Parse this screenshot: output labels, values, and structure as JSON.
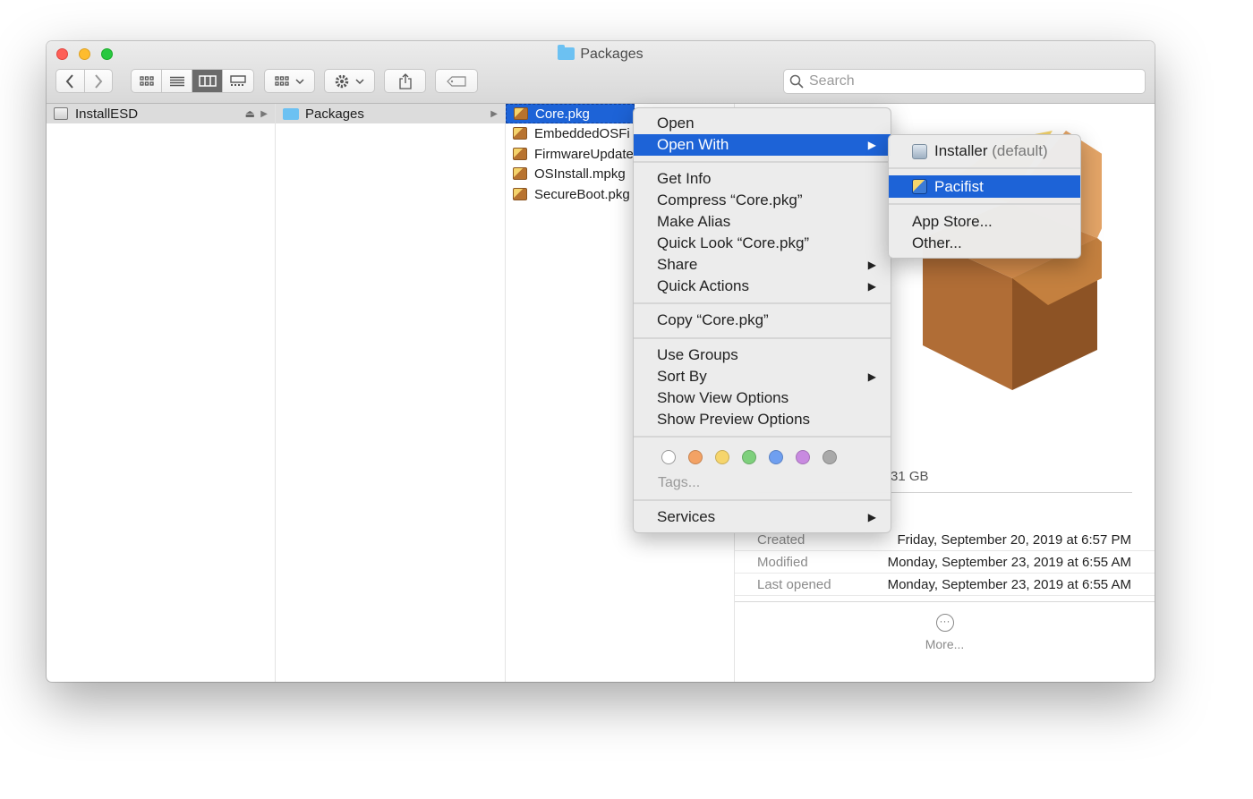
{
  "window": {
    "title": "Packages"
  },
  "toolbar": {
    "search_placeholder": "Search"
  },
  "columns": {
    "col1": [
      {
        "label": "InstallESD"
      }
    ],
    "col2": [
      {
        "label": "Packages"
      }
    ],
    "col3": [
      {
        "label": "Core.pkg"
      },
      {
        "label": "EmbeddedOSFi"
      },
      {
        "label": "FirmwareUpdate"
      },
      {
        "label": "OSInstall.mpkg"
      },
      {
        "label": "SecureBoot.pkg"
      }
    ]
  },
  "preview": {
    "size_fragment": "31 GB",
    "meta": [
      {
        "key": "Created",
        "value": "Friday, September 20, 2019 at 6:57 PM"
      },
      {
        "key": "Modified",
        "value": "Monday, September 23, 2019 at 6:55 AM"
      },
      {
        "key": "Last opened",
        "value": "Monday, September 23, 2019 at 6:55 AM"
      }
    ],
    "more_label": "More..."
  },
  "context_menu": {
    "items": [
      "Open",
      "Open With",
      "Get Info",
      "Compress “Core.pkg”",
      "Make Alias",
      "Quick Look “Core.pkg”",
      "Share",
      "Quick Actions",
      "Copy “Core.pkg”",
      "Use Groups",
      "Sort By",
      "Show View Options",
      "Show Preview Options",
      "Tags...",
      "Services"
    ],
    "tag_colors": [
      "#ffffff",
      "#f3a264",
      "#f6d56c",
      "#7ed07c",
      "#6f9ff0",
      "#c88ae0",
      "#a9a9a9"
    ]
  },
  "submenu": {
    "installer_name": "Installer",
    "installer_suffix": "(default)",
    "pacifist": "Pacifist",
    "app_store": "App Store...",
    "other": "Other..."
  }
}
